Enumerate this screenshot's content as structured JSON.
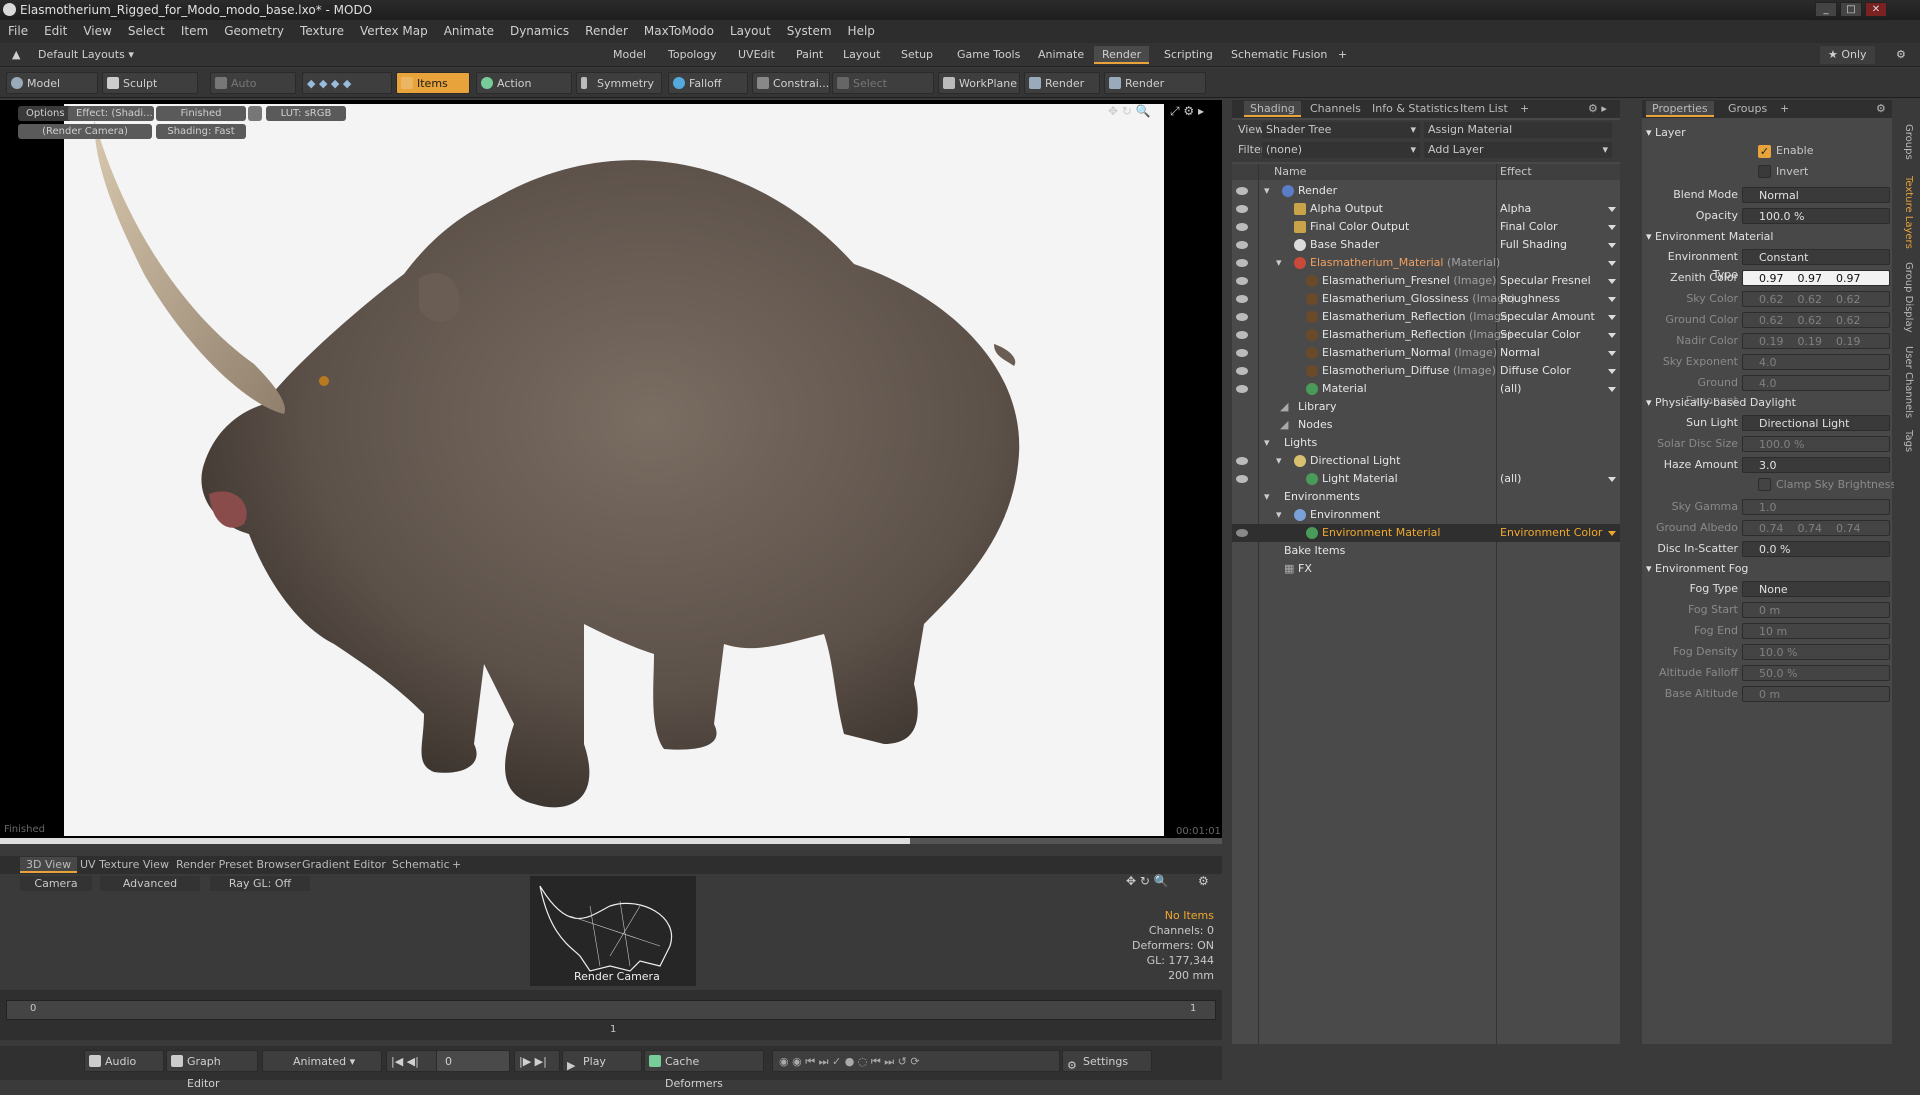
{
  "window": {
    "title": "Elasmotherium_Rigged_for_Modo_modo_base.lxo* - MODO"
  },
  "menu": [
    "File",
    "Edit",
    "View",
    "Select",
    "Item",
    "Geometry",
    "Texture",
    "Vertex Map",
    "Animate",
    "Dynamics",
    "Render",
    "MaxToModo",
    "Layout",
    "System",
    "Help"
  ],
  "layoutbar": {
    "default_layouts": "Default Layouts",
    "tabs": [
      "Model",
      "Topology",
      "UVEdit",
      "Paint",
      "Layout",
      "Setup",
      "Game Tools",
      "Animate",
      "Render",
      "Scripting",
      "Schematic Fusion"
    ],
    "active_tab": "Render",
    "only": "Only"
  },
  "toolbar": {
    "model": "Model",
    "sculpt": "Sculpt",
    "auto_select": "Auto Select",
    "items": "Items",
    "action_center": "Action Center",
    "symmetry": "Symmetry",
    "falloff": "Falloff",
    "constraints": "Constrai...",
    "select_through": "Select Through",
    "workplane": "WorkPlane",
    "render": "Render",
    "render_window": "Render Window"
  },
  "viewport": {
    "options": "Options",
    "effect": "Effect: (Shadi...",
    "finished_pill": "Finished",
    "lut": "LUT: sRGB",
    "camera": "(Render Camera)",
    "shading": "Shading: Fast",
    "status": "Finished",
    "time": "00:01:01"
  },
  "bottom_tabs": [
    "3D View",
    "UV Texture View",
    "Render Preset Browser",
    "Gradient Editor",
    "Schematic"
  ],
  "lower_view": {
    "camera": "Camera",
    "advanced": "Advanced",
    "raygl": "Ray GL: Off",
    "render_camera": "Render Camera",
    "info": [
      "No Items",
      "Channels: 0",
      "Deformers: ON",
      "GL: 177,344",
      "200 mm"
    ]
  },
  "timeline": {
    "start": "0",
    "mid": "1",
    "end": "1"
  },
  "statusbar": {
    "audio": "Audio",
    "graph_editor": "Graph Editor",
    "animated": "Animated",
    "frame": "0",
    "play": "Play",
    "cache": "Cache Deformers",
    "settings": "Settings"
  },
  "shading_panel": {
    "tabs": [
      "Shading",
      "Channels",
      "Info & Statistics",
      "Item List"
    ],
    "view_label": "View",
    "view_value": "Shader Tree",
    "assign_material": "Assign Material",
    "filter_label": "Filter",
    "filter_value": "(none)",
    "add_layer": "Add Layer",
    "col_name": "Name",
    "col_effect": "Effect",
    "rows": [
      {
        "name": "Render",
        "tag": "",
        "effect": ""
      },
      {
        "name": "Alpha Output",
        "tag": "",
        "effect": "Alpha"
      },
      {
        "name": "Final Color Output",
        "tag": "",
        "effect": "Final Color"
      },
      {
        "name": "Base Shader",
        "tag": "",
        "effect": "Full Shading"
      },
      {
        "name": "Elasmatherium_Material",
        "tag": "(Material)",
        "effect": ""
      },
      {
        "name": "Elasmatherium_Fresnel",
        "tag": "(Image)",
        "effect": "Specular Fresnel"
      },
      {
        "name": "Elasmatherium_Glossiness",
        "tag": "(Image)",
        "effect": "Roughness"
      },
      {
        "name": "Elasmatherium_Reflection",
        "tag": "(Image...",
        "effect": "Specular Amount"
      },
      {
        "name": "Elasmatherium_Reflection",
        "tag": "(Image)",
        "effect": "Specular Color"
      },
      {
        "name": "Elasmatherium_Normal",
        "tag": "(Image)",
        "effect": "Normal"
      },
      {
        "name": "Elasmotherium_Diffuse",
        "tag": "(Image)",
        "effect": "Diffuse Color"
      },
      {
        "name": "Material",
        "tag": "",
        "effect": "(all)"
      },
      {
        "name": "Library",
        "tag": "",
        "effect": ""
      },
      {
        "name": "Nodes",
        "tag": "",
        "effect": ""
      },
      {
        "name": "Lights",
        "tag": "",
        "effect": ""
      },
      {
        "name": "Directional Light",
        "tag": "",
        "effect": ""
      },
      {
        "name": "Light Material",
        "tag": "",
        "effect": "(all)"
      },
      {
        "name": "Environments",
        "tag": "",
        "effect": ""
      },
      {
        "name": "Environment",
        "tag": "",
        "effect": ""
      },
      {
        "name": "Environment Material",
        "tag": "",
        "effect": "Environment Color"
      },
      {
        "name": "Bake Items",
        "tag": "",
        "effect": ""
      },
      {
        "name": "FX",
        "tag": "",
        "effect": ""
      }
    ]
  },
  "properties": {
    "tabs": [
      "Properties",
      "Groups"
    ],
    "layer": "Layer",
    "enable": "Enable",
    "invert": "Invert",
    "blend_mode_label": "Blend Mode",
    "blend_mode": "Normal",
    "opacity_label": "Opacity",
    "opacity": "100.0 %",
    "env_material": "Environment Material",
    "env_type_label": "Environment Type",
    "env_type": "Constant",
    "zenith_label": "Zenith Color",
    "zenith": "0.97    0.97    0.97",
    "sky_color_label": "Sky Color",
    "sky_color": "0.62    0.62    0.62",
    "ground_color_label": "Ground Color",
    "ground_color": "0.62    0.62    0.62",
    "nadir_label": "Nadir Color",
    "nadir": "0.19    0.19    0.19",
    "sky_exp_label": "Sky Exponent",
    "sky_exp": "4.0",
    "ground_exp_label": "Ground Exponent",
    "ground_exp": "4.0",
    "daylight": "Physically-based Daylight",
    "sun_light_label": "Sun Light",
    "sun_light": "Directional Light",
    "solar_disc_label": "Solar Disc Size",
    "solar_disc": "100.0 %",
    "haze_label": "Haze Amount",
    "haze": "3.0",
    "clamp": "Clamp Sky Brightness",
    "sky_gamma_label": "Sky Gamma",
    "sky_gamma": "1.0",
    "ground_albedo_label": "Ground Albedo",
    "ground_albedo": "0.74    0.74    0.74",
    "disc_scatter_label": "Disc In-Scatter",
    "disc_scatter": "0.0 %",
    "fog": "Environment Fog",
    "fog_type_label": "Fog Type",
    "fog_type": "None",
    "fog_start_label": "Fog Start",
    "fog_start": "0 m",
    "fog_end_label": "Fog End",
    "fog_end": "10 m",
    "fog_density_label": "Fog Density",
    "fog_density": "10.0 %",
    "alt_falloff_label": "Altitude Falloff",
    "alt_falloff": "50.0 %",
    "base_alt_label": "Base Altitude",
    "base_alt": "0 m"
  },
  "side_tabs": [
    "Groups",
    "Texture Layers",
    "Group Display",
    "User Channels",
    "Tags"
  ],
  "colors": {
    "accent": "#e8a33a",
    "selection": "#f0a830"
  }
}
